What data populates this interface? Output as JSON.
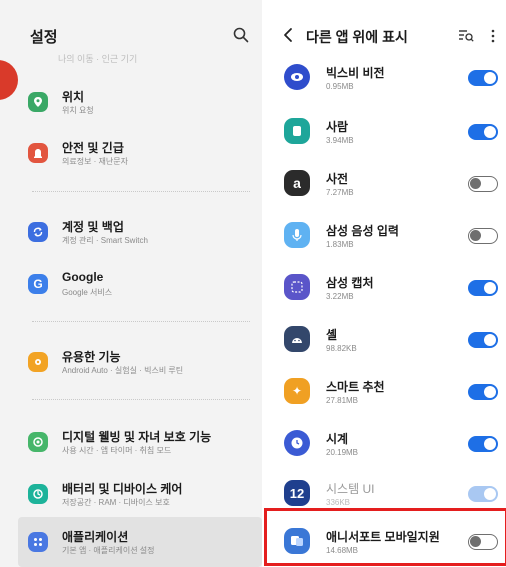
{
  "left": {
    "title": "설정",
    "faded_top_text": "나의 이동 · 인근 기기",
    "items": [
      {
        "title": "위치",
        "sub": "위치 요청",
        "icon": "location-pin-icon",
        "color": "#3aa866"
      },
      {
        "title": "안전 및 긴급",
        "sub": "의료정보 · 재난문자",
        "icon": "alert-icon",
        "color": "#e2553f"
      },
      {
        "title": "계정 및 백업",
        "sub": "계정 관리 · Smart Switch",
        "icon": "sync-icon",
        "color": "#3c6ee0"
      },
      {
        "title": "Google",
        "sub": "Google 서비스",
        "icon": "google-icon",
        "color": "#3c7fea"
      },
      {
        "title": "유용한 기능",
        "sub": "Android Auto · 실험실 · 빅스비 루틴",
        "icon": "star-icon",
        "color": "#f2a324"
      },
      {
        "title": "디지털 웰빙 및 자녀 보호 기능",
        "sub": "사용 시간 · 앱 타이머 · 취침 모드",
        "icon": "wellbeing-icon",
        "color": "#46b66a"
      },
      {
        "title": "배터리 및 디바이스 케어",
        "sub": "저장공간 · RAM · 디바이스 보호",
        "icon": "device-care-icon",
        "color": "#1db39a"
      },
      {
        "title": "애플리케이션",
        "sub": "기본 앱 · 애플리케이션 설정",
        "icon": "apps-grid-icon",
        "color": "#4a78e2"
      }
    ]
  },
  "right": {
    "title": "다른 앱 위에 표시",
    "apps": [
      {
        "name": "빅스비 비전",
        "size": "0.95MB",
        "on": true,
        "icon": "bixby-vision-icon",
        "color": "#2f4dcc"
      },
      {
        "name": "사람",
        "size": "3.94MB",
        "on": true,
        "icon": "contacts-icon",
        "color": "#1ea69a"
      },
      {
        "name": "사전",
        "size": "7.27MB",
        "on": false,
        "icon": "dictionary-icon",
        "color": "#2b2b2b"
      },
      {
        "name": "삼성 음성 입력",
        "size": "1.83MB",
        "on": false,
        "icon": "voice-input-icon",
        "color": "#5fb2f2"
      },
      {
        "name": "삼성 캡처",
        "size": "3.22MB",
        "on": true,
        "icon": "capture-icon",
        "color": "#5a55c9"
      },
      {
        "name": "셸",
        "size": "98.82KB",
        "on": true,
        "icon": "android-icon",
        "color": "#33476b"
      },
      {
        "name": "스마트 추천",
        "size": "27.81MB",
        "on": true,
        "icon": "smart-suggest-icon",
        "color": "#f0a023"
      },
      {
        "name": "시계",
        "size": "20.19MB",
        "on": true,
        "icon": "clock-icon",
        "color": "#3b5bd4"
      },
      {
        "name": "시스템 UI",
        "size": "336KB",
        "on": true,
        "disabled": true,
        "icon": "one-ui-icon",
        "color": "#1f3f8e"
      },
      {
        "name": "애니서포트 모바일지원",
        "size": "14.68MB",
        "on": false,
        "icon": "anysupport-icon",
        "color": "#3a77d6"
      }
    ]
  },
  "colors": {
    "toggle_on": "#1e6fe6",
    "highlight": "#e41e1e"
  }
}
